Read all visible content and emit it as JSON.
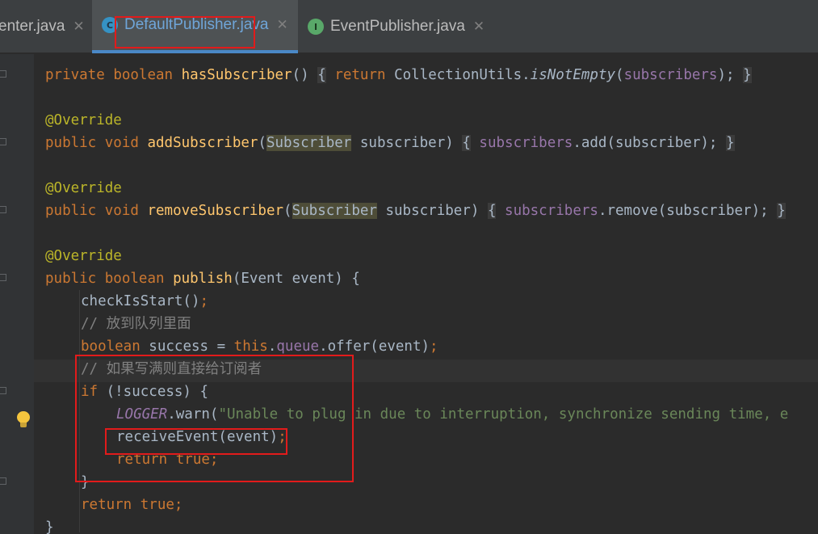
{
  "tabs": [
    {
      "label": "enter.java",
      "close": "✕"
    },
    {
      "label": "DefaultPublisher.java",
      "close": "✕",
      "icon_text": "C"
    },
    {
      "label": "EventPublisher.java",
      "close": "✕",
      "icon_text": "I"
    }
  ],
  "code": {
    "l1": {
      "kw1": "private",
      "kw2": "boolean",
      "fn": "hasSubscriber",
      "p": "()",
      "ob": "{",
      "kw3": "return",
      "cls": "CollectionUtils.",
      "m": "isNotEmpty",
      "a1": "(",
      "fld": "subscribers",
      "a2": ");",
      "cb": "}"
    },
    "l2": {
      "ann": "@Override"
    },
    "l3": {
      "kw1": "public",
      "kw2": "void",
      "fn": "addSubscriber",
      "p1": "(",
      "type": "Subscriber",
      "p2": " subscriber)",
      "ob": "{",
      "fld": "subscribers",
      "rest": ".add(subscriber);",
      "cb": "}"
    },
    "l4": {
      "ann": "@Override"
    },
    "l5": {
      "kw1": "public",
      "kw2": "void",
      "fn": "removeSubscriber",
      "p1": "(",
      "type": "Subscriber",
      "p2": " subscriber)",
      "ob": "{",
      "fld": "subscribers",
      "rest": ".remove(subscriber);",
      "cb": "}"
    },
    "l6": {
      "ann": "@Override"
    },
    "l7": {
      "kw1": "public",
      "kw2": "boolean",
      "fn": "publish",
      "rest": "(Event event) {"
    },
    "l8": {
      "call": "checkIsStart()",
      "semi": ";"
    },
    "l9": {
      "cm": "// 放到队列里面"
    },
    "l10": {
      "kw": "boolean",
      "v": " success = ",
      "kw2": "this",
      "dot": ".",
      "fld": "queue",
      "rest": ".offer(event)",
      "semi": ";"
    },
    "l11": {
      "cm": "// 如果写满则直接给订阅者"
    },
    "l12": {
      "kw": "if",
      "rest": " (!success) {"
    },
    "l13": {
      "logger": "LOGGER",
      "rest": ".warn(",
      "str": "\"Unable to plug in due to interruption, synchronize sending time, e"
    },
    "l14": {
      "call": "receiveEvent(event)",
      "semi": ";"
    },
    "l15": {
      "kw": "return",
      "v": " true",
      "semi": ";"
    },
    "l16": {
      "cb": "}"
    },
    "l17": {
      "kw": "return",
      "v": " true",
      "semi": ";"
    },
    "l18": {
      "cb": "}"
    }
  },
  "colors": {
    "annotation_red": "#e21b1b",
    "background": "#2b2b2b",
    "keyword": "#cc7832",
    "method": "#ffc66d",
    "field": "#9876aa",
    "string": "#6a8759",
    "comment": "#808080"
  }
}
